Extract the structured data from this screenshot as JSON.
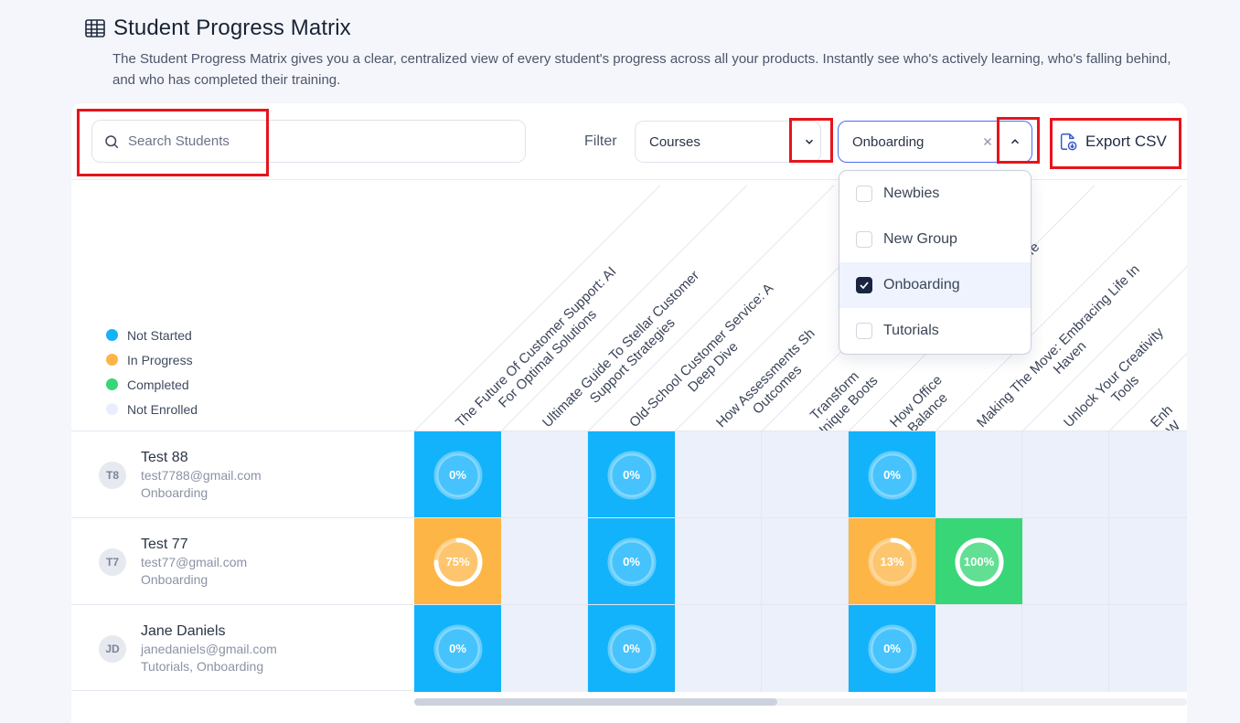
{
  "page": {
    "title": "Student Progress Matrix",
    "description": "The Student Progress Matrix gives you a clear, centralized view of every student's progress across all your products. Instantly see who's actively learning, who's falling behind, and who has completed their training."
  },
  "toolbar": {
    "search_placeholder": "Search Students",
    "filter_label": "Filter",
    "type_select_value": "Courses",
    "group_select_value": "Onboarding",
    "export_label": "Export CSV"
  },
  "group_dropdown": {
    "options": [
      {
        "label": "Newbies",
        "checked": false
      },
      {
        "label": "New Group",
        "checked": false
      },
      {
        "label": "Onboarding",
        "checked": true
      },
      {
        "label": "Tutorials",
        "checked": false
      }
    ]
  },
  "legend": [
    {
      "label": "Not Started",
      "color": "#12b3fb"
    },
    {
      "label": "In Progress",
      "color": "#fdb545"
    },
    {
      "label": "Completed",
      "color": "#38d677"
    },
    {
      "label": "Not Enrolled",
      "color": "#e9eefb"
    }
  ],
  "columns": [
    {
      "line1": "The Future Of Customer Support: AI",
      "line2": "For Optimal Solutions"
    },
    {
      "line1": "Ultimate Guide To Stellar Customer",
      "line2": "Support Strategies"
    },
    {
      "line1": "Old-School Customer Service: A",
      "line2": "Deep Dive"
    },
    {
      "line1": "How Assessments Sh",
      "line2": "Outcomes"
    },
    {
      "line1": "Transform",
      "line2": "Unique Boots"
    },
    {
      "line1": "How Office",
      "line2": "Balance",
      "extra": "Work-Life"
    },
    {
      "line1": "Making The Move: Embracing Life In",
      "line2": "Haven"
    },
    {
      "line1": "Unlock Your Creativity",
      "line2": "Tools"
    },
    {
      "line1": "Enh",
      "line2": "W"
    }
  ],
  "students": [
    {
      "initials": "T8",
      "name": "Test 88",
      "email": "test7788@gmail.com",
      "groups": "Onboarding",
      "cells": [
        {
          "status": "blue",
          "pct": "0%",
          "value": 0
        },
        {
          "status": "none"
        },
        {
          "status": "blue",
          "pct": "0%",
          "value": 0
        },
        {
          "status": "none"
        },
        {
          "status": "none"
        },
        {
          "status": "blue",
          "pct": "0%",
          "value": 0
        },
        {
          "status": "none"
        },
        {
          "status": "none"
        },
        {
          "status": "none"
        }
      ]
    },
    {
      "initials": "T7",
      "name": "Test 77",
      "email": "test77@gmail.com",
      "groups": "Onboarding",
      "cells": [
        {
          "status": "orange",
          "pct": "75%",
          "value": 75
        },
        {
          "status": "none"
        },
        {
          "status": "blue",
          "pct": "0%",
          "value": 0
        },
        {
          "status": "none"
        },
        {
          "status": "none"
        },
        {
          "status": "orange",
          "pct": "13%",
          "value": 13
        },
        {
          "status": "green",
          "pct": "100%",
          "value": 100
        },
        {
          "status": "none"
        },
        {
          "status": "none"
        }
      ]
    },
    {
      "initials": "JD",
      "name": "Jane Daniels",
      "email": "janedaniels@gmail.com",
      "groups": "Tutorials, Onboarding",
      "cells": [
        {
          "status": "blue",
          "pct": "0%",
          "value": 0
        },
        {
          "status": "none"
        },
        {
          "status": "blue",
          "pct": "0%",
          "value": 0
        },
        {
          "status": "none"
        },
        {
          "status": "none"
        },
        {
          "status": "blue",
          "pct": "0%",
          "value": 0
        },
        {
          "status": "none"
        },
        {
          "status": "none"
        },
        {
          "status": "none"
        }
      ]
    }
  ],
  "scrollbar": {
    "position": 0.0,
    "visible_fraction": 0.47
  }
}
